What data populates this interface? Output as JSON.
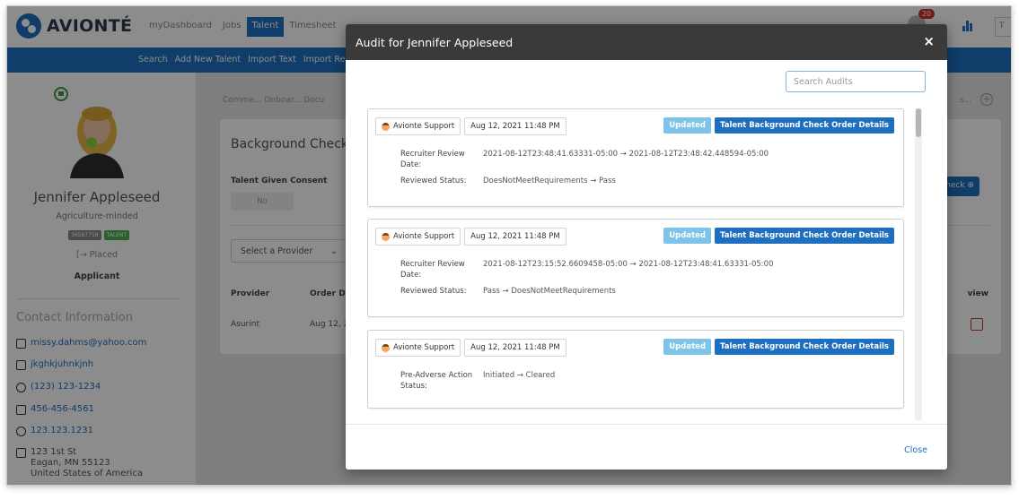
{
  "app": {
    "logo_text": "AVIONTÉ",
    "top_nav": [
      "myDashboard",
      "Jobs",
      "Talent",
      "Timesheet"
    ],
    "active_top_nav": "Talent",
    "notification_count": "20",
    "user_box_text": "T",
    "sub_nav": [
      "Search",
      "Add New Talent",
      "Import Text",
      "Import Re"
    ]
  },
  "talent": {
    "name": "Jennifer Appleseed",
    "subtitle": "Agriculture-minded",
    "id_badge": "36587758",
    "type_badge": "TALENT",
    "placed": "[→ Placed",
    "status": "Applicant",
    "contact_title": "Contact Information",
    "email": "missy.dahms@yahoo.com",
    "handle": "jkghkjuhnkjnh",
    "phone1": "(123) 123-1234",
    "phone2": "456-456-4561",
    "phone3": "123.123.1231",
    "address_line1": "123 1st St",
    "address_line2": "Eagan, MN 55123",
    "address_line3": "United States of America"
  },
  "main": {
    "crumbs": "Comme...  Onboar...  Docu",
    "more": "s...",
    "card_title": "Background Checks",
    "consent_label": "Talent Given Consent",
    "consent_value": "No",
    "provider_placeholder": "Select a Provider",
    "check_button": "heck ⊕",
    "columns": {
      "provider": "Provider",
      "order": "Order Da",
      "review": "view"
    },
    "row": {
      "provider": "Asurint",
      "order": "Aug 12, 2"
    }
  },
  "modal": {
    "title": "Audit for Jennifer Appleseed",
    "close_x": "×",
    "search_placeholder": "Search Audits",
    "close_button": "Close",
    "audits": [
      {
        "user": "Avionte Support",
        "timestamp": "Aug 12, 2021 11:48 PM",
        "action": "Updated",
        "entity": "Talent Background Check Order Details",
        "changes": [
          {
            "label": "Recruiter Review Date:",
            "value": "2021-08-12T23:48:41.63331-05:00 → 2021-08-12T23:48:42.448594-05:00"
          },
          {
            "label": "Reviewed Status:",
            "value": "DoesNotMeetRequirements → Pass"
          }
        ]
      },
      {
        "user": "Avionte Support",
        "timestamp": "Aug 12, 2021 11:48 PM",
        "action": "Updated",
        "entity": "Talent Background Check Order Details",
        "changes": [
          {
            "label": "Recruiter Review Date:",
            "value": "2021-08-12T23:15:52.6609458-05:00 → 2021-08-12T23:48:41.63331-05:00"
          },
          {
            "label": "Reviewed Status:",
            "value": "Pass → DoesNotMeetRequirements"
          }
        ]
      },
      {
        "user": "Avionte Support",
        "timestamp": "Aug 12, 2021 11:48 PM",
        "action": "Updated",
        "entity": "Talent Background Check Order Details",
        "changes": [
          {
            "label": "Pre-Adverse Action Status:",
            "value": "Initiated → Cleared"
          }
        ]
      }
    ]
  },
  "colors": {
    "brand_blue": "#1e6fc0",
    "updated_tag": "#7dc4e8",
    "modal_header": "#3a3a3a"
  }
}
